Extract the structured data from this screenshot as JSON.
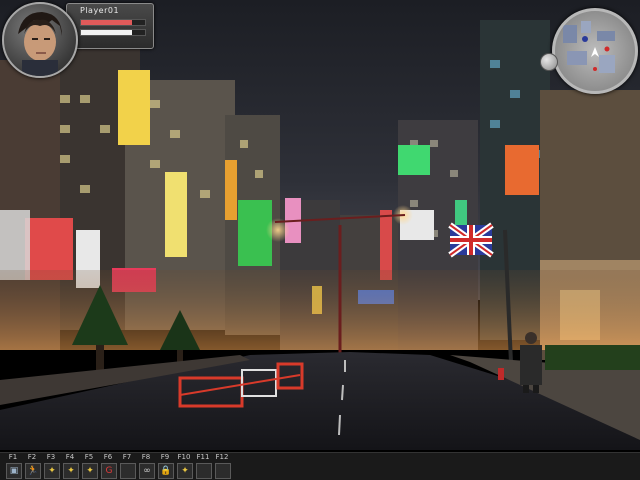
{
  "player": {
    "name": "Player01",
    "health_fraction": 0.8,
    "mana_fraction": 0.8
  },
  "minimap": {
    "icon": "compass-map-icon"
  },
  "hotbar": {
    "slots": [
      {
        "key": "F1",
        "icon": "portrait-icon",
        "glyph": "▣",
        "color": "#9db3c9"
      },
      {
        "key": "F2",
        "icon": "running-man-icon",
        "glyph": "🏃",
        "color": "#44d24a"
      },
      {
        "key": "F3",
        "icon": "bulb-icon",
        "glyph": "✦",
        "color": "#e8c642"
      },
      {
        "key": "F4",
        "icon": "bulb-icon",
        "glyph": "✦",
        "color": "#e8c642"
      },
      {
        "key": "F5",
        "icon": "bulb-icon",
        "glyph": "✦",
        "color": "#e8c642"
      },
      {
        "key": "F6",
        "icon": "g-emblem-icon",
        "glyph": "G",
        "color": "#e03b3b"
      },
      {
        "key": "F7",
        "icon": "empty-slot",
        "glyph": "",
        "color": "#888888"
      },
      {
        "key": "F8",
        "icon": "link-icon",
        "glyph": "∞",
        "color": "#cfcfcf"
      },
      {
        "key": "F9",
        "icon": "lock-icon",
        "glyph": "🔒",
        "color": "#e8c642"
      },
      {
        "key": "F10",
        "icon": "bulb-icon",
        "glyph": "✦",
        "color": "#e8c642"
      },
      {
        "key": "F11",
        "icon": "empty-slot",
        "glyph": "",
        "color": "#888888"
      },
      {
        "key": "F12",
        "icon": "empty-slot",
        "glyph": "",
        "color": "#888888"
      }
    ]
  }
}
